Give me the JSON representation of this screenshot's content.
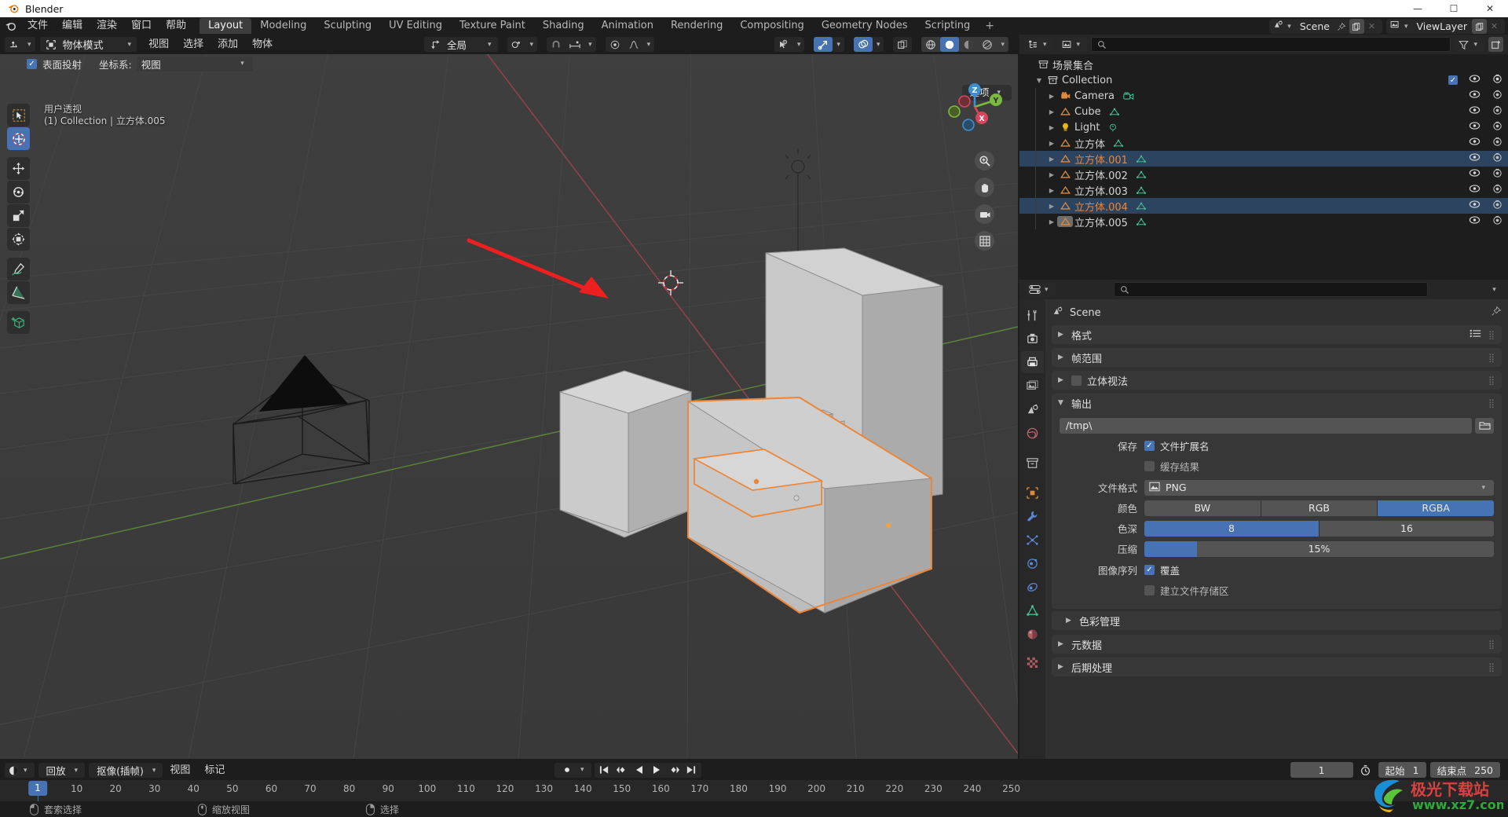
{
  "window": {
    "title": "Blender",
    "minimize": "—",
    "maximize": "☐",
    "close": "✕"
  },
  "topbar": {
    "menus": [
      "文件",
      "编辑",
      "渲染",
      "窗口",
      "帮助"
    ],
    "workspace_tabs": [
      "Layout",
      "Modeling",
      "Sculpting",
      "UV Editing",
      "Texture Paint",
      "Shading",
      "Animation",
      "Rendering",
      "Compositing",
      "Geometry Nodes",
      "Scripting"
    ],
    "active_tab": "Layout",
    "add_tab": "+",
    "scene_name": "Scene",
    "viewlayer_name": "ViewLayer"
  },
  "viewport": {
    "mode": "物体模式",
    "menus": [
      "视图",
      "选择",
      "添加",
      "物体"
    ],
    "transform_orientation": "全局",
    "surface_project_label": "表面投射",
    "orientation_label": "坐标系:",
    "orientation_value": "视图",
    "options_label": "选项",
    "overlay_line1": "用户透视",
    "overlay_line2": "(1) Collection | 立方体.005",
    "gizmo_axes": {
      "x": "X",
      "y": "Y",
      "z": "Z"
    },
    "tools": [
      {
        "name": "tweak-tool",
        "label": "调整"
      },
      {
        "name": "select-box-tool",
        "label": "框选",
        "active": true
      },
      {
        "name": "move-tool",
        "label": "移动"
      },
      {
        "name": "rotate-tool",
        "label": "旋转"
      },
      {
        "name": "scale-tool",
        "label": "缩放"
      },
      {
        "name": "transform-tool",
        "label": "变换"
      },
      {
        "name": "annotate-tool",
        "label": "标注"
      },
      {
        "name": "measure-tool",
        "label": "测量"
      },
      {
        "name": "add-cube-tool",
        "label": "添加立方体"
      }
    ],
    "shading_modes": [
      "wireframe",
      "solid",
      "material",
      "rendered"
    ],
    "active_shading": "solid"
  },
  "outliner": {
    "root": "场景集合",
    "search_placeholder": "",
    "collection": "Collection",
    "items": [
      {
        "name": "Camera",
        "type": "camera",
        "selected": false,
        "active": false
      },
      {
        "name": "Cube",
        "type": "mesh",
        "selected": false,
        "active": false
      },
      {
        "name": "Light",
        "type": "light",
        "selected": false,
        "active": false
      },
      {
        "name": "立方体",
        "type": "mesh",
        "selected": false,
        "active": false
      },
      {
        "name": "立方体.001",
        "type": "mesh",
        "selected": true,
        "active": false
      },
      {
        "name": "立方体.002",
        "type": "mesh",
        "selected": false,
        "active": false
      },
      {
        "name": "立方体.003",
        "type": "mesh",
        "selected": false,
        "active": false
      },
      {
        "name": "立方体.004",
        "type": "mesh",
        "selected": true,
        "active": false
      },
      {
        "name": "立方体.005",
        "type": "mesh",
        "selected": false,
        "active": true
      }
    ]
  },
  "properties": {
    "breadcrumb_scene": "Scene",
    "panels": [
      {
        "label": "格式",
        "open": false,
        "has_preset": true
      },
      {
        "label": "帧范围",
        "open": false,
        "has_preset": false
      },
      {
        "label": "立体视法",
        "open": false,
        "has_checkbox": true,
        "checked": false
      },
      {
        "label": "输出",
        "open": true,
        "has_preset": false
      }
    ],
    "output": {
      "path": "/tmp\\",
      "save_label": "保存",
      "file_extension_label": "文件扩展名",
      "file_extension_checked": true,
      "cache_result_label": "缓存结果",
      "cache_result_checked": false,
      "file_format_label": "文件格式",
      "file_format_value": "PNG",
      "color_label": "颜色",
      "color_options": [
        "BW",
        "RGB",
        "RGBA"
      ],
      "color_selected": "RGBA",
      "depth_label": "色深",
      "depth_options": [
        "8",
        "16"
      ],
      "depth_selected": "8",
      "compression_label": "压缩",
      "compression_value": "15%",
      "compression_percent": 15,
      "sequence_label": "图像序列",
      "overwrite_label": "覆盖",
      "overwrite_checked": true,
      "placeholder_label": "建立文件存储区",
      "placeholder_checked": false,
      "color_management_label": "色彩管理"
    },
    "tail_panels": [
      {
        "label": "元数据"
      },
      {
        "label": "后期处理"
      }
    ]
  },
  "timeline": {
    "editor_label": "",
    "menus": [
      "回放",
      "抠像(插帧)",
      "视图",
      "标记"
    ],
    "current_frame": "1",
    "start_label": "起始",
    "start_value": "1",
    "end_label": "结束点",
    "end_value": "250",
    "ticks": [
      "10",
      "20",
      "30",
      "40",
      "50",
      "60",
      "70",
      "80",
      "90",
      "100",
      "110",
      "120",
      "130",
      "140",
      "150",
      "160",
      "170",
      "180",
      "190",
      "200",
      "210",
      "220",
      "230",
      "240",
      "250"
    ],
    "playhead_label": "1"
  },
  "statusbar": {
    "items": [
      {
        "mouse": "left",
        "label": "套索选择"
      },
      {
        "mouse": "middle",
        "label": "缩放视图"
      },
      {
        "mouse": "right",
        "label": "选择"
      }
    ]
  },
  "watermark": {
    "title": "极光下载站",
    "url": "www.xz7.com"
  },
  "colors": {
    "accent": "#4772b3",
    "selected_outline": "#ed8535",
    "background": "#3b3b3b",
    "panel": "#303030",
    "header": "#1d1d1d"
  }
}
